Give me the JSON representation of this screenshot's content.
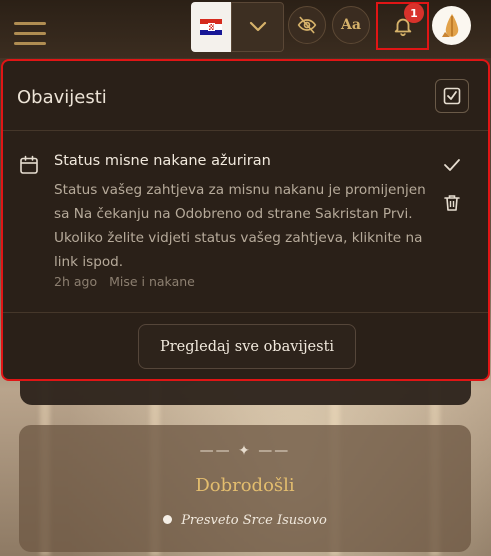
{
  "header": {
    "language_flag": "croatia-flag-icon",
    "notification_count": "1",
    "font_size_label": "Aa"
  },
  "notifications": {
    "title": "Obavijesti",
    "items": [
      {
        "title": "Status misne nakane ažuriran",
        "body": "Status vašeg zahtjeva za misnu nakanu je promijenjen sa Na čekanju na Odobreno od strane Sakristan Prvi. Ukoliko želite vidjeti status vašeg zahtjeva, kliknite na link ispod.",
        "time": "2h ago",
        "category": "Mise i nakane"
      }
    ],
    "view_all_label": "Pregledaj sve obavijesti"
  },
  "welcome": {
    "ornament": "—— ✦ ——",
    "title": "Dobrodošli",
    "parish": "Presveto Srce Isusovo"
  },
  "colors": {
    "accent_gold": "#d6b26a",
    "badge_red": "#d8322b",
    "highlight_red": "#e01515",
    "panel_bg": "#2a2018"
  }
}
